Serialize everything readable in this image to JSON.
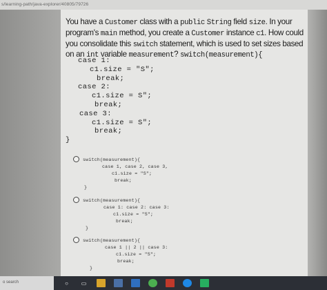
{
  "browser": {
    "url": "s/learning-path/java-explorer/40805/79726"
  },
  "question": {
    "p1": "You have a ",
    "class_name": "Customer",
    "p2": " class with a ",
    "public_kw": "public",
    "string_kw": "String",
    "p3": " field ",
    "field_name": "size",
    "p4": ". In your program's ",
    "main_kw": "main",
    "p5": " method, you create a ",
    "customer_kw": "Customer",
    "p6": " instance ",
    "c1": "c1",
    "p7": ". How could you consolidate this ",
    "switch_kw": "switch",
    "p8": " statement, which is used to set sizes based on an ",
    "int_kw": "int",
    "p9": " variable ",
    "measurement_kw": "measurement",
    "p10": "? ",
    "switch_expr": "switch(measurement){"
  },
  "code_lines": [
    "case 1:",
    "c1.size = \"S\";",
    "break;",
    "case 2:",
    "c1.size = S\";",
    "break;",
    "case 3:",
    "c1.size = S\";",
    "break;",
    "}"
  ],
  "options": [
    {
      "lines": [
        "switch(measurement){",
        "case 1, case 2, case 3,",
        "c1.size = \"S\";",
        "break;",
        "}"
      ]
    },
    {
      "lines": [
        "switch(measurement){",
        "case 1: case 2: case 3:",
        "c1.size = \"S\";",
        "break;",
        "}"
      ]
    },
    {
      "lines": [
        "switch(measurement){",
        "case 1 || 2 || case 3:",
        "c1.size = \"S\";",
        "break;",
        "}"
      ]
    }
  ],
  "taskbar": {
    "search_placeholder": "o search"
  }
}
